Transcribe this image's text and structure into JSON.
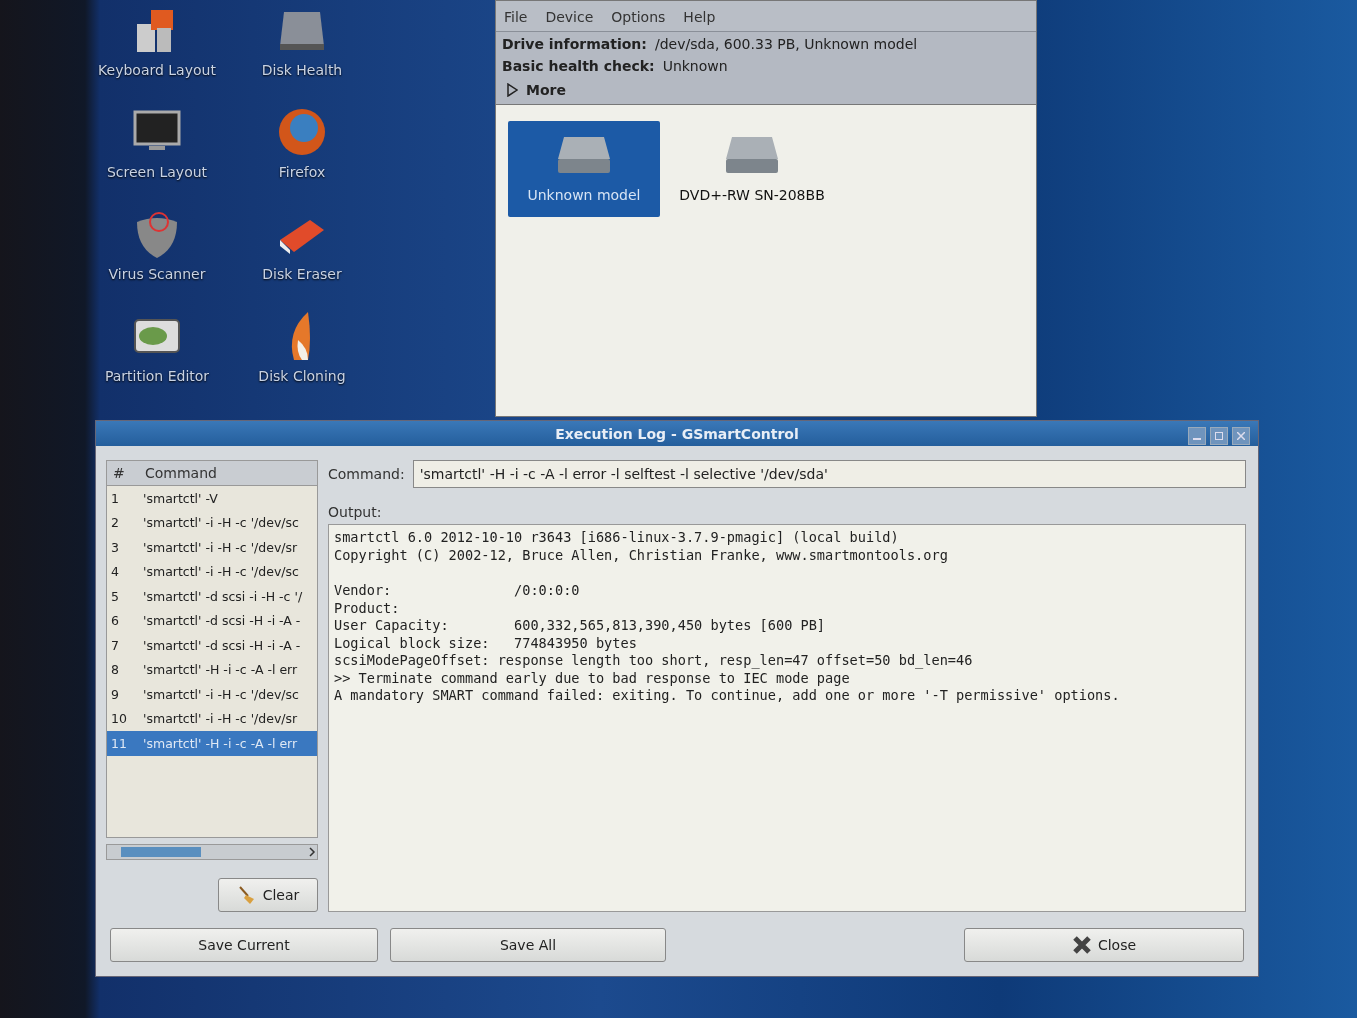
{
  "desktop_icons": [
    {
      "label": "Keyboard Layout",
      "kind": "keyboard"
    },
    {
      "label": "Disk Health",
      "kind": "disk"
    },
    {
      "label": "Screen Layout",
      "kind": "monitor"
    },
    {
      "label": "Firefox",
      "kind": "browser"
    },
    {
      "label": "Virus Scanner",
      "kind": "shield"
    },
    {
      "label": "Disk Eraser",
      "kind": "eraser"
    },
    {
      "label": "Partition Editor",
      "kind": "partition"
    },
    {
      "label": "Disk Cloning",
      "kind": "flame"
    }
  ],
  "main_window": {
    "menu": [
      "File",
      "Device",
      "Options",
      "Help"
    ],
    "info": [
      {
        "label": "Drive information:",
        "value": "/dev/sda, 600.33 PB, Unknown model"
      },
      {
        "label": "Basic health check:",
        "value": "Unknown"
      }
    ],
    "more": {
      "label": "More",
      "expanded": false
    },
    "devices": [
      {
        "label": "Unknown model",
        "selected": true
      },
      {
        "label": "DVD+-RW SN-208BB",
        "selected": false
      }
    ]
  },
  "log_window": {
    "title": "Execution Log - GSmartControl",
    "columns": [
      "#",
      "Command"
    ],
    "rows": [
      {
        "number": "1",
        "command": "'smartctl' -V",
        "selected": false
      },
      {
        "number": "2",
        "command": "'smartctl' -i -H -c '/dev/sc",
        "selected": false
      },
      {
        "number": "3",
        "command": "'smartctl' -i -H -c '/dev/sr",
        "selected": false
      },
      {
        "number": "4",
        "command": "'smartctl' -i -H -c '/dev/sc",
        "selected": false
      },
      {
        "number": "5",
        "command": "'smartctl' -d scsi -i -H -c '/",
        "selected": false
      },
      {
        "number": "6",
        "command": "'smartctl' -d scsi -H -i -A -",
        "selected": false
      },
      {
        "number": "7",
        "command": "'smartctl' -d scsi -H -i -A -",
        "selected": false
      },
      {
        "number": "8",
        "command": "'smartctl' -H -i -c -A -l err",
        "selected": false
      },
      {
        "number": "9",
        "command": "'smartctl' -i -H -c '/dev/sc",
        "selected": false
      },
      {
        "number": "10",
        "command": "'smartctl' -i -H -c '/dev/sr",
        "selected": false
      },
      {
        "number": "11",
        "command": "'smartctl' -H -i -c -A -l err",
        "selected": true
      }
    ],
    "clear_button": "Clear",
    "command_label": "Command:",
    "command_value": "'smartctl' -H -i -c -A -l error -l selftest -l selective '/dev/sda'",
    "output_label": "Output:",
    "output_blocks": [
      {
        "lines": [
          "smartctl 6.0 2012-10-10 r3643 [i686-linux-3.7.9-pmagic] (local build)",
          "Copyright (C) 2002-12, Bruce Allen, Christian Franke, www.smartmontools.org"
        ]
      },
      {
        "lines": [
          "Vendor:               /0:0:0:0",
          "Product:",
          "User Capacity:        600,332,565,813,390,450 bytes [600 PB]",
          "Logical block size:   774843950 bytes",
          "scsiModePageOffset: response length too short, resp_len=47 offset=50 bd_len=46",
          ">> Terminate command early due to bad response to IEC mode page",
          "A mandatory SMART command failed: exiting. To continue, add one or more '-T permissive' options."
        ]
      }
    ],
    "buttons": [
      {
        "label": "Save Current",
        "kind": "plain"
      },
      {
        "label": "Save All",
        "kind": "plain"
      },
      {
        "label": "Close",
        "kind": "close"
      }
    ]
  }
}
